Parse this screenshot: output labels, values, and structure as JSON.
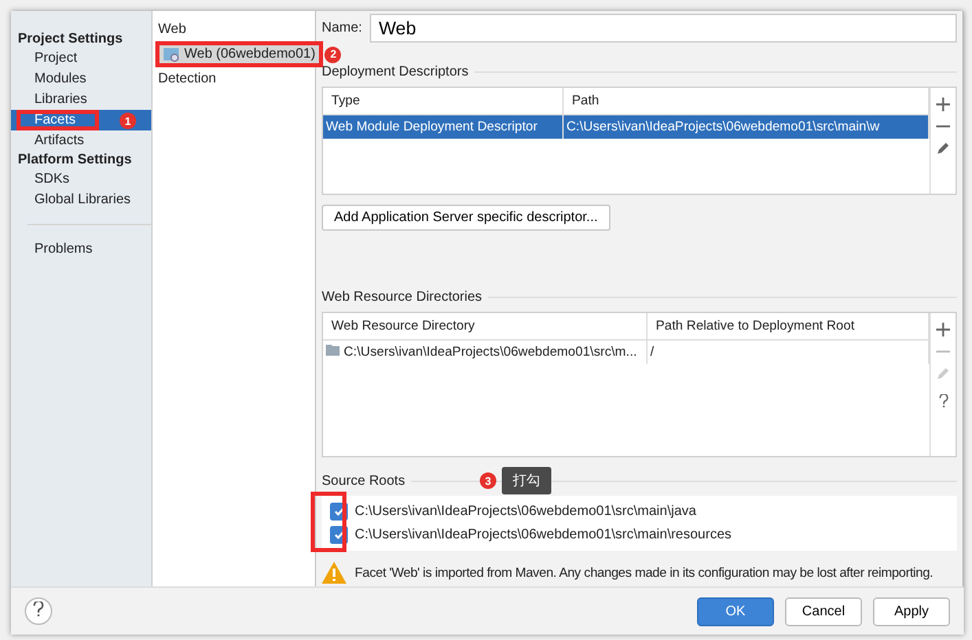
{
  "sidebar": {
    "sections": [
      {
        "title": "Project Settings",
        "items": [
          {
            "label": "Project",
            "selected": false
          },
          {
            "label": "Modules",
            "selected": false
          },
          {
            "label": "Libraries",
            "selected": false
          },
          {
            "label": "Facets",
            "selected": true
          },
          {
            "label": "Artifacts",
            "selected": false
          }
        ]
      },
      {
        "title": "Platform Settings",
        "items": [
          {
            "label": "SDKs",
            "selected": false
          },
          {
            "label": "Global Libraries",
            "selected": false
          }
        ]
      }
    ],
    "extra_items": [
      {
        "label": "Problems",
        "selected": false
      }
    ]
  },
  "facets_tree": {
    "group": "Web",
    "items": [
      {
        "label": "Web (06webdemo01)",
        "selected": true
      }
    ],
    "detection": "Detection"
  },
  "name_field": {
    "label": "Name:",
    "value": "Web"
  },
  "deployment_descriptors": {
    "title": "Deployment Descriptors",
    "columns": [
      "Type",
      "Path"
    ],
    "rows": [
      {
        "cells": [
          "Web Module Deployment Descriptor",
          "C:\\Users\\ivan\\IdeaProjects\\06webdemo01\\src\\main\\w"
        ],
        "selected": true
      }
    ],
    "add_button": "Add Application Server specific descriptor..."
  },
  "web_resource_directories": {
    "title": "Web Resource Directories",
    "columns": [
      "Web Resource Directory",
      "Path Relative to Deployment Root"
    ],
    "rows": [
      {
        "cells": [
          "C:\\Users\\ivan\\IdeaProjects\\06webdemo01\\src\\m...",
          "/"
        ],
        "selected": false
      }
    ]
  },
  "source_roots": {
    "title": "Source Roots",
    "items": [
      {
        "path": "C:\\Users\\ivan\\IdeaProjects\\06webdemo01\\src\\main\\java",
        "checked": true
      },
      {
        "path": "C:\\Users\\ivan\\IdeaProjects\\06webdemo01\\src\\main\\resources",
        "checked": true
      }
    ]
  },
  "warning": "Facet 'Web' is imported from Maven. Any changes made in its configuration may be lost after reimporting.",
  "buttons": [
    {
      "label": "OK",
      "kind": "primary"
    },
    {
      "label": "Cancel",
      "kind": "normal"
    },
    {
      "label": "Apply",
      "kind": "normal"
    }
  ],
  "annotations": [
    {
      "number": "1"
    },
    {
      "number": "2"
    },
    {
      "number": "3",
      "note": "打勾"
    }
  ]
}
